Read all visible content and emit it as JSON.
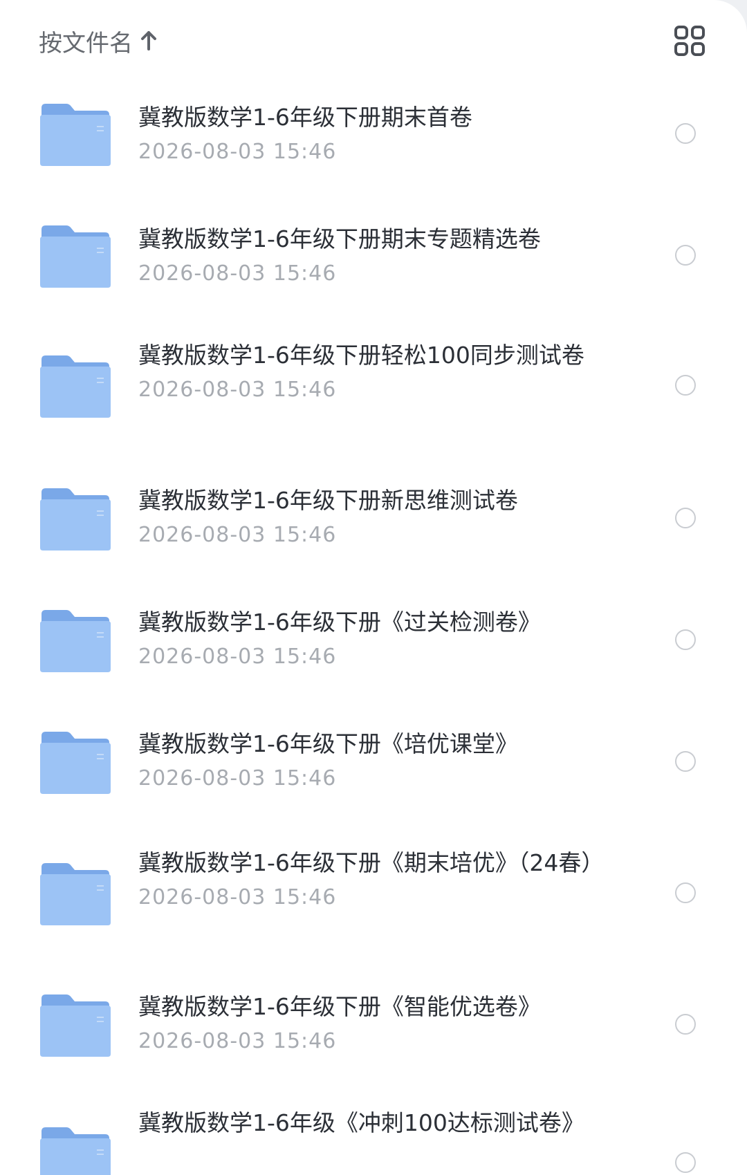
{
  "header": {
    "sort_label": "按文件名",
    "sort_icon": "arrow-up-icon",
    "view_icon": "grid-view-icon"
  },
  "files": [
    {
      "name": "冀教版数学1-6年级下册期末首卷",
      "date": "2026-08-03 15:46"
    },
    {
      "name": "冀教版数学1-6年级下册期末专题精选卷",
      "date": "2026-08-03 15:46"
    },
    {
      "name": "冀教版数学1-6年级下册轻松100同步测试卷",
      "date": "2026-08-03 15:46"
    },
    {
      "name": "冀教版数学1-6年级下册新思维测试卷",
      "date": "2026-08-03 15:46"
    },
    {
      "name": "冀教版数学1-6年级下册《过关检测卷》",
      "date": "2026-08-03 15:46"
    },
    {
      "name": "冀教版数学1-6年级下册《培优课堂》",
      "date": "2026-08-03 15:46"
    },
    {
      "name": "冀教版数学1-6年级下册《期末培优》（24春）",
      "date": "2026-08-03 15:46"
    },
    {
      "name": "冀教版数学1-6年级下册《智能优选卷》",
      "date": "2026-08-03 15:46"
    },
    {
      "name": "冀教版数学1-6年级《冲刺100达标测试卷》",
      "date": ""
    }
  ],
  "colors": {
    "folder_back": "#7aa8e8",
    "folder_front": "#9cc3f5",
    "title_text": "#2b2f36",
    "date_text": "#a7abb1"
  }
}
